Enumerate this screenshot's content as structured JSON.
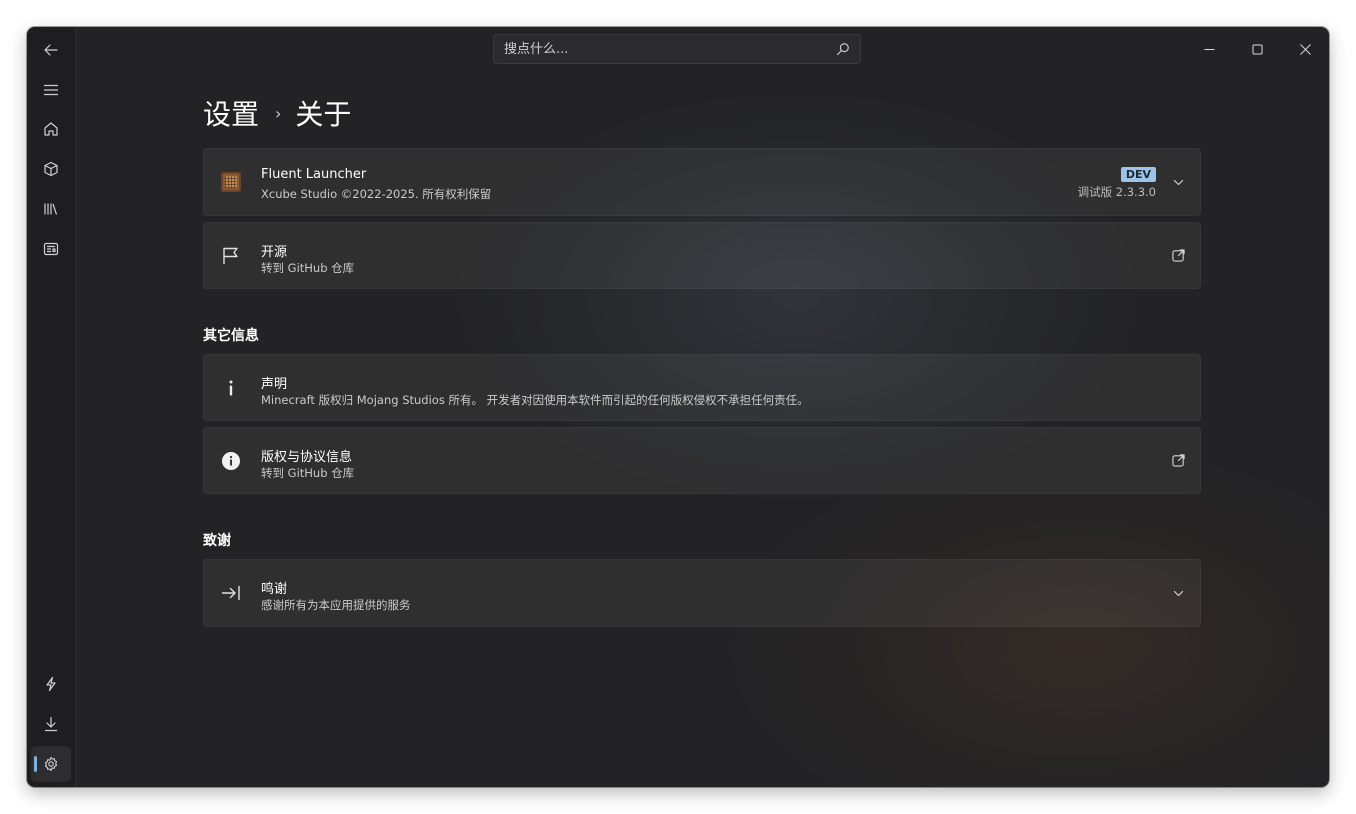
{
  "titlebar": {
    "search_placeholder": "搜点什么..."
  },
  "breadcrumb": {
    "parent": "设置",
    "separator": "›",
    "current": "关于"
  },
  "app_card": {
    "title": "Fluent Launcher",
    "subtitle": "Xcube Studio ©2022-2025. 所有权利保留",
    "badge": "DEV",
    "version": "调试版 2.3.3.0"
  },
  "open_source_card": {
    "title": "开源",
    "subtitle": "转到 GitHub 仓库"
  },
  "section_other": {
    "header": "其它信息"
  },
  "disclaimer_card": {
    "title": "声明",
    "subtitle": "Minecraft 版权归 Mojang Studios 所有。 开发者对因使用本软件而引起的任何版权侵权不承担任何责任。"
  },
  "license_card": {
    "title": "版权与协议信息",
    "subtitle": "转到 GitHub 仓库"
  },
  "section_thanks": {
    "header": "致谢"
  },
  "thanks_card": {
    "title": "鸣谢",
    "subtitle": "感谢所有为本应用提供的服务"
  },
  "nav": {
    "top_icons": [
      "back-icon",
      "menu-icon",
      "home-icon",
      "cube-icon",
      "library-icon",
      "news-icon"
    ],
    "bottom_icons": [
      "flash-icon",
      "download-icon",
      "settings-icon"
    ],
    "active": "settings-icon"
  },
  "colors": {
    "window_bg": "#232325",
    "card_bg": "#2e2e30",
    "accent": "#7fb0e0",
    "badge_bg": "#9dc4e8"
  }
}
